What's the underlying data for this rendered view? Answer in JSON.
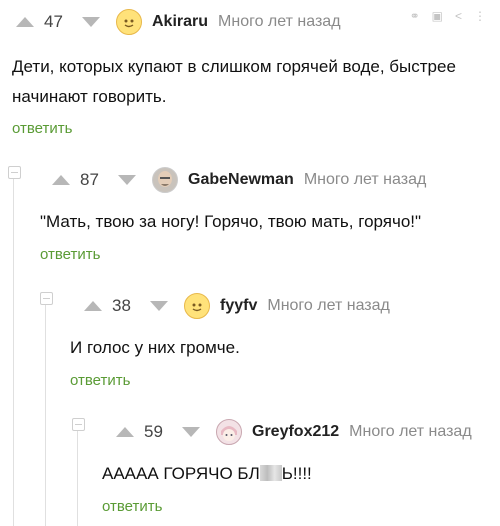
{
  "comments": [
    {
      "rating": "47",
      "nick": "Akiraru",
      "time": "Много лет назад",
      "text_lines": [
        "Дети, которых купают в слишком горячей воде, быстрее",
        "начинают говорить."
      ],
      "reply_label": "ответить",
      "avatar": "yellow-face-icon"
    },
    {
      "rating": "87",
      "nick": "GabeNewman",
      "time": "Много лет назад",
      "text": "\"Мать, твою за ногу! Горячо, твою мать, горячо!\"",
      "reply_label": "ответить",
      "avatar": "gabe-photo"
    },
    {
      "rating": "38",
      "nick": "fyyfv",
      "time": "Много лет назад",
      "text": "И голос у них громче.",
      "reply_label": "ответить",
      "avatar": "yellow-face-icon"
    },
    {
      "rating": "59",
      "nick": "Greyfox212",
      "time": "Много лет назад",
      "text_before": "АААAА ГОРЯЧО БЛ",
      "text_after": "Ь!!!!",
      "reply_label": "ответить",
      "avatar": "anime-avatar"
    }
  ],
  "colors": {
    "reply": "#5a9b35",
    "vote": "#b7b7b7",
    "meta": "#8a8a8a"
  }
}
